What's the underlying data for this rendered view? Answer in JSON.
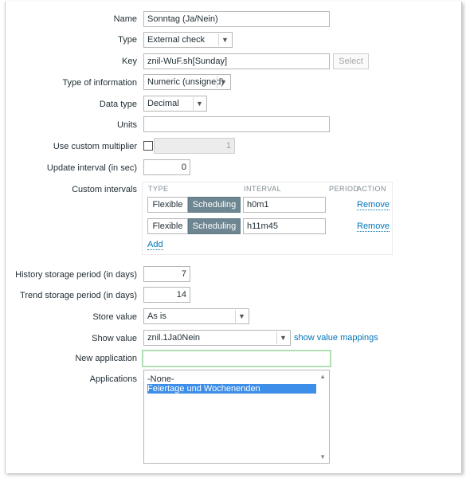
{
  "form": {
    "name": {
      "label": "Name",
      "value": "Sonntag (Ja/Nein)"
    },
    "type": {
      "label": "Type",
      "value": "External check"
    },
    "key": {
      "label": "Key",
      "value": "znil-WuF.sh[Sunday]",
      "select_button": "Select"
    },
    "type_of_information": {
      "label": "Type of information",
      "value": "Numeric (unsigned)"
    },
    "data_type": {
      "label": "Data type",
      "value": "Decimal"
    },
    "units": {
      "label": "Units",
      "value": ""
    },
    "custom_multiplier": {
      "label": "Use custom multiplier",
      "value": "1",
      "checked": false
    },
    "update_interval": {
      "label": "Update interval (in sec)",
      "value": "0"
    },
    "custom_intervals": {
      "label": "Custom intervals",
      "headers": [
        "TYPE",
        "INTERVAL",
        "PERIOD",
        "ACTION"
      ],
      "rows": [
        {
          "flexible": "Flexible",
          "scheduling": "Scheduling",
          "interval": "h0m1",
          "action": "Remove"
        },
        {
          "flexible": "Flexible",
          "scheduling": "Scheduling",
          "interval": "h11m45",
          "action": "Remove"
        }
      ],
      "add": "Add"
    },
    "history": {
      "label": "History storage period (in days)",
      "value": "7"
    },
    "trends": {
      "label": "Trend storage period (in days)",
      "value": "14"
    },
    "store_value": {
      "label": "Store value",
      "value": "As is"
    },
    "show_value": {
      "label": "Show value",
      "value": "znil.1Ja0Nein",
      "link": "show value mappings"
    },
    "new_application": {
      "label": "New application",
      "value": ""
    },
    "applications": {
      "label": "Applications",
      "items": [
        "-None-",
        "Feiertage und Wochenenden"
      ],
      "selected_index": 1
    }
  },
  "colors": {
    "accent": "#0275b8",
    "selection": "#3d8ee8",
    "segment_active": "#6e8691",
    "focus": "#aee0b4"
  }
}
